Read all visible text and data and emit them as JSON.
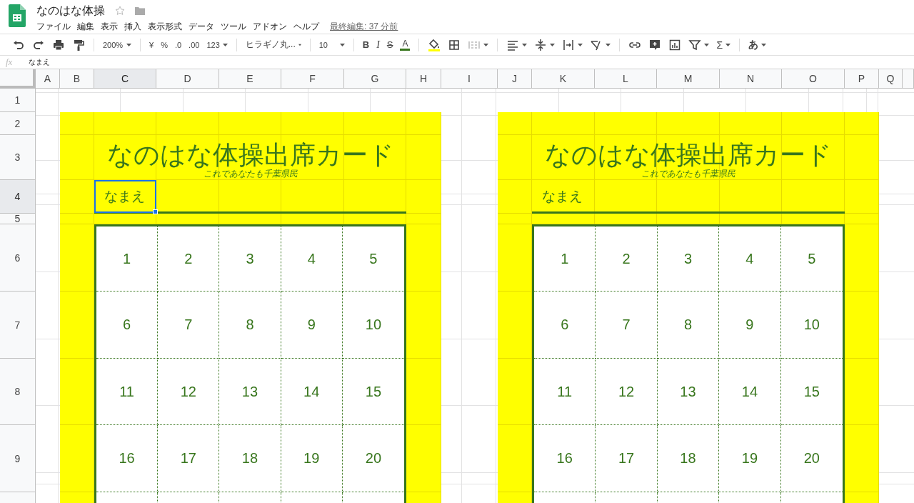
{
  "document": {
    "title": "なのはな体操",
    "starred": false
  },
  "menu": [
    "ファイル",
    "編集",
    "表示",
    "挿入",
    "表示形式",
    "データ",
    "ツール",
    "アドオン",
    "ヘルプ"
  ],
  "last_edit": "最終編集: 37 分前",
  "toolbar": {
    "zoom": "200%",
    "currency": "¥",
    "percent": "%",
    "decrease_decimal": ".0",
    "increase_decimal": ".00",
    "number_format": "123",
    "font": "ヒラギノ丸...",
    "font_size": "10",
    "bold": "B",
    "italic": "I",
    "strikethrough": "S",
    "text_color": "A",
    "functions": "Σ",
    "input_tools": "あ"
  },
  "formula_bar": {
    "label": "fx",
    "value": "なまえ"
  },
  "sheet": {
    "columns": [
      {
        "label": "A",
        "selected": false
      },
      {
        "label": "B",
        "selected": false
      },
      {
        "label": "C",
        "selected": true
      },
      {
        "label": "D",
        "selected": false
      },
      {
        "label": "E",
        "selected": false
      },
      {
        "label": "F",
        "selected": false
      },
      {
        "label": "G",
        "selected": false
      },
      {
        "label": "H",
        "selected": false
      },
      {
        "label": "I",
        "selected": false
      },
      {
        "label": "J",
        "selected": false
      },
      {
        "label": "K",
        "selected": false
      },
      {
        "label": "L",
        "selected": false
      },
      {
        "label": "M",
        "selected": false
      },
      {
        "label": "N",
        "selected": false
      },
      {
        "label": "O",
        "selected": false
      },
      {
        "label": "P",
        "selected": false
      },
      {
        "label": "Q",
        "selected": false
      }
    ],
    "rows": [
      {
        "label": "1",
        "selected": false
      },
      {
        "label": "2",
        "selected": false
      },
      {
        "label": "3",
        "selected": false
      },
      {
        "label": "4",
        "selected": true
      },
      {
        "label": "5",
        "selected": false
      },
      {
        "label": "6",
        "selected": false
      },
      {
        "label": "7",
        "selected": false
      },
      {
        "label": "8",
        "selected": false
      },
      {
        "label": "9",
        "selected": false
      }
    ],
    "cards": [
      {
        "title": "なのはな体操出席カード",
        "subtitle": "これであなたも千葉県民",
        "name_label": "なまえ",
        "name_selected": true,
        "numbers": [
          "1",
          "2",
          "3",
          "4",
          "5",
          "6",
          "7",
          "8",
          "9",
          "10",
          "11",
          "12",
          "13",
          "14",
          "15",
          "16",
          "17",
          "18",
          "19",
          "20"
        ]
      },
      {
        "title": "なのはな体操出席カード",
        "subtitle": "これであなたも千葉県民",
        "name_label": "なまえ",
        "name_selected": false,
        "numbers": [
          "1",
          "2",
          "3",
          "4",
          "5",
          "6",
          "7",
          "8",
          "9",
          "10",
          "11",
          "12",
          "13",
          "14",
          "15",
          "16",
          "17",
          "18",
          "19",
          "20"
        ]
      }
    ]
  }
}
